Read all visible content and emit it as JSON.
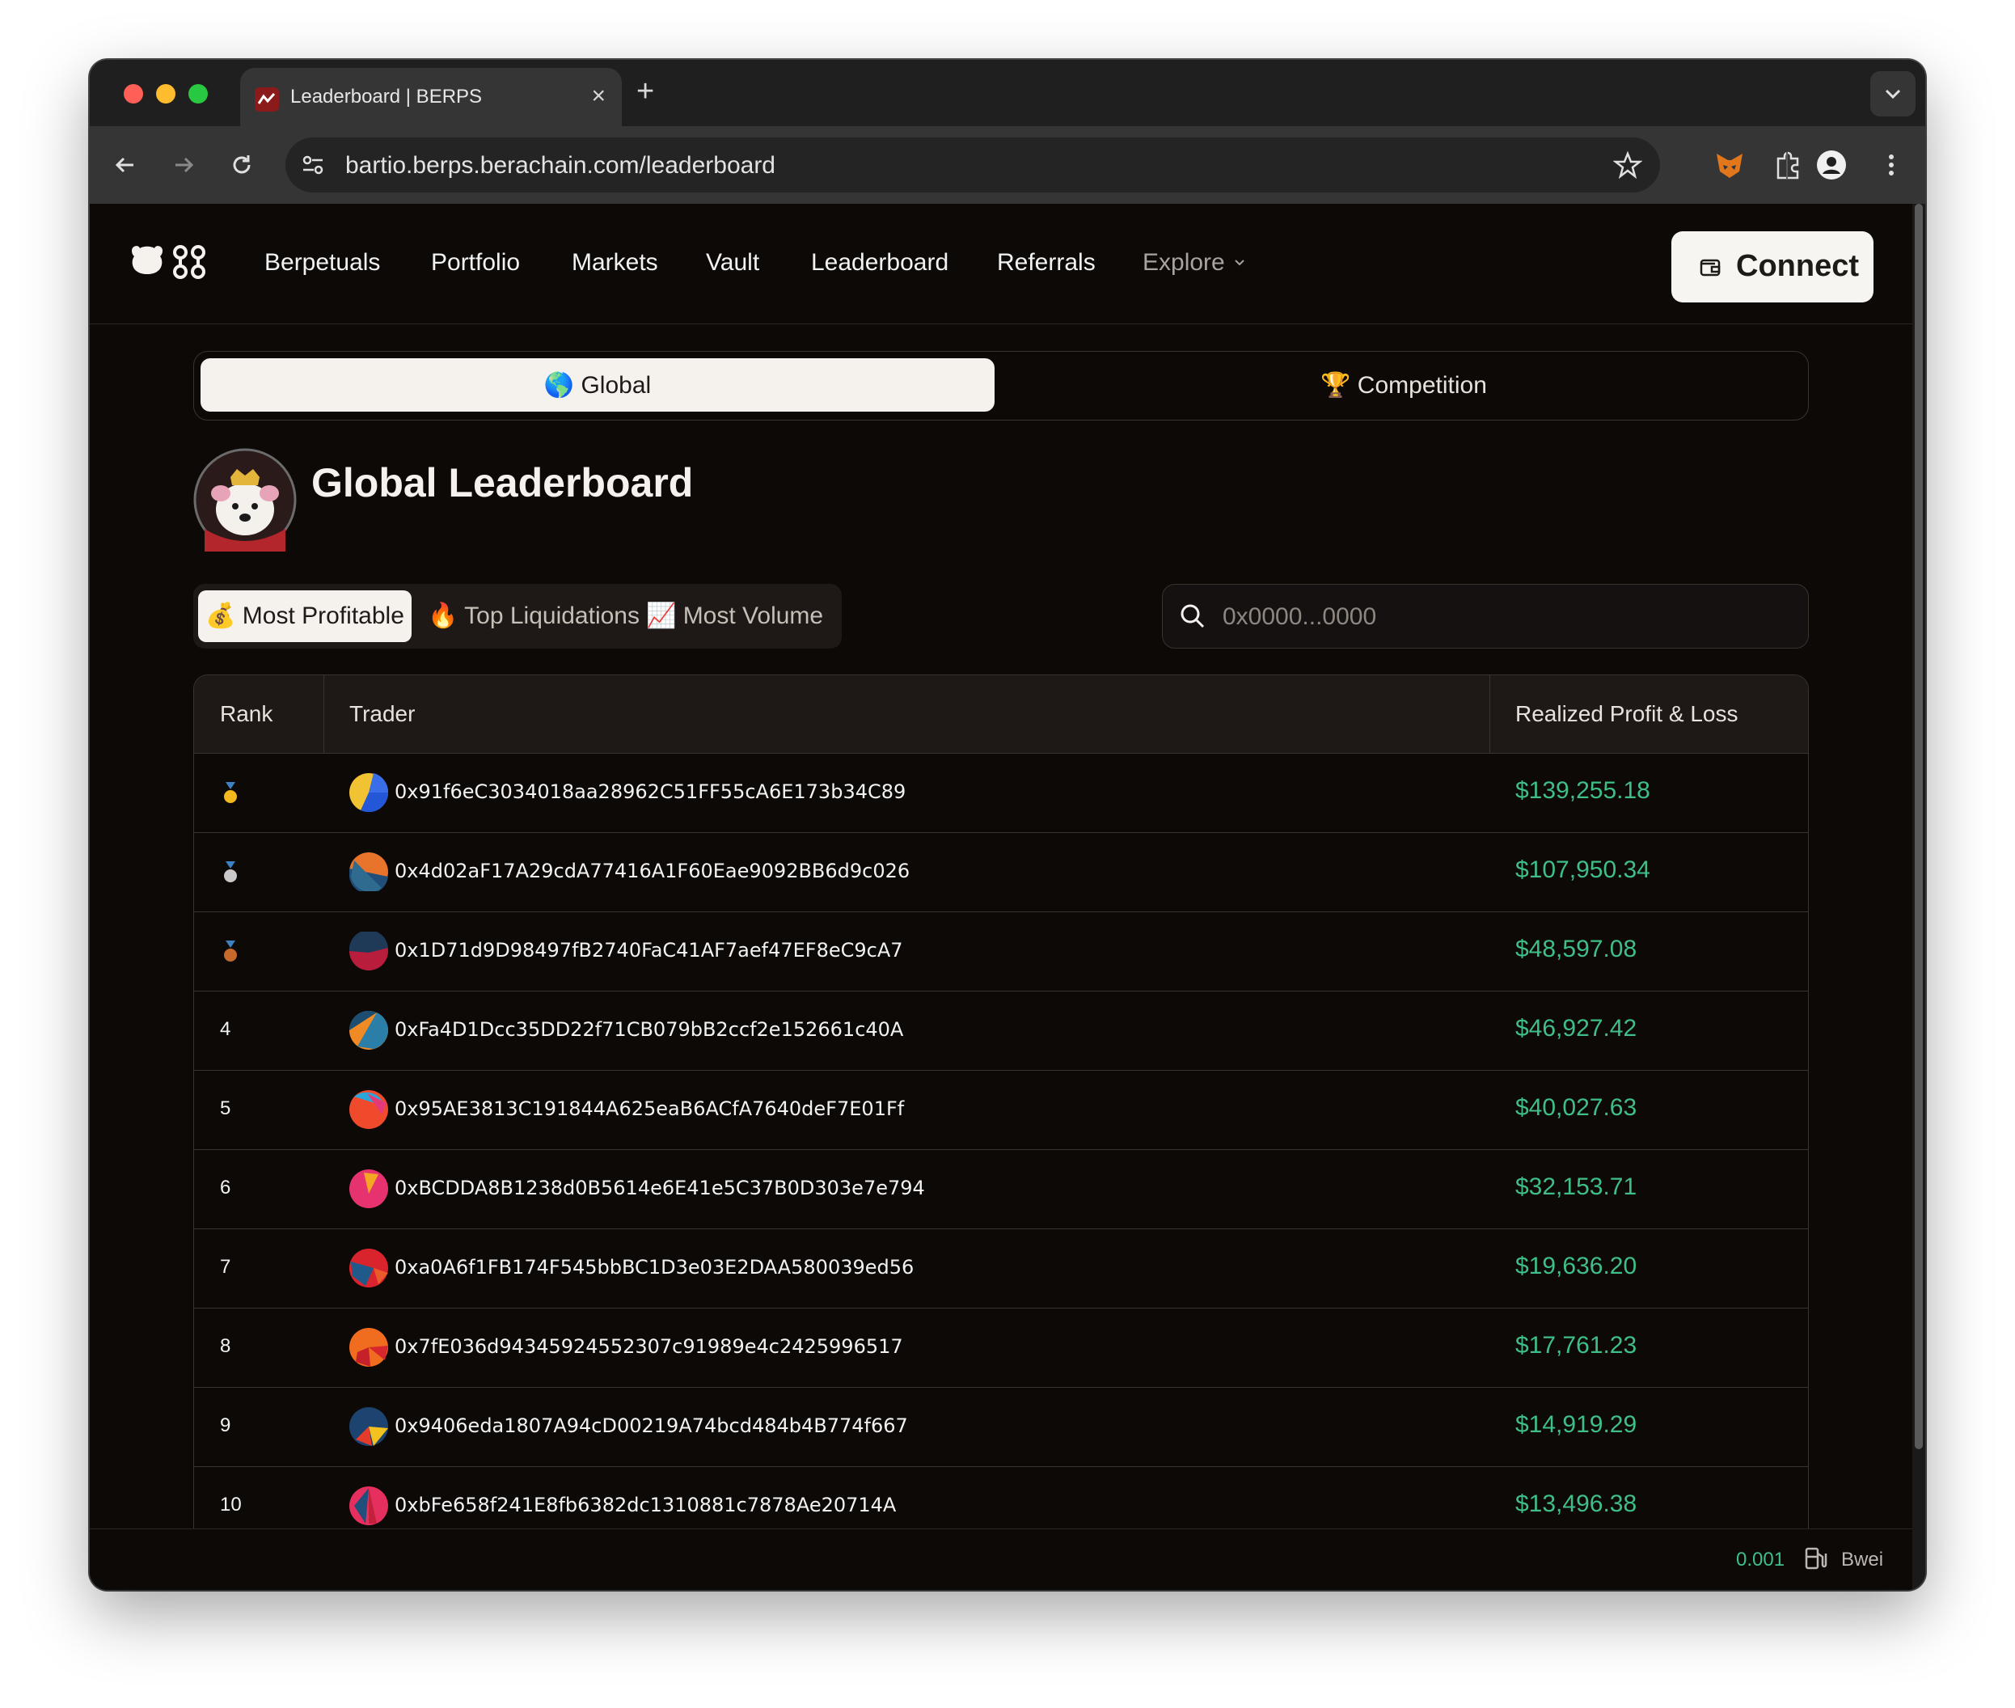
{
  "browser": {
    "tab_title": "Leaderboard | BERPS",
    "url": "bartio.berps.berachain.com/leaderboard"
  },
  "nav": {
    "items": [
      "Berpetuals",
      "Portfolio",
      "Markets",
      "Vault",
      "Leaderboard",
      "Referrals"
    ],
    "explore": "Explore",
    "connect": "Connect"
  },
  "segments": {
    "global": "🌎 Global",
    "competition": "🏆 Competition"
  },
  "title": "Global Leaderboard",
  "filters": {
    "most_profitable": "💰 Most Profitable",
    "top_liquidations": "🔥 Top Liquidations",
    "most_volume": "📈 Most Volume"
  },
  "search": {
    "placeholder": "0x0000...0000"
  },
  "table": {
    "headers": {
      "rank": "Rank",
      "trader": "Trader",
      "pnl": "Realized Profit & Loss"
    },
    "rows": [
      {
        "rank": "",
        "medal": "gold-medal-icon",
        "address": "0x91f6eC3034018aa28962C51FF55cA6E173b34C89",
        "pnl": "$139,255.18"
      },
      {
        "rank": "",
        "medal": "silver-medal-icon",
        "address": "0x4d02aF17A29cdA77416A1F60Eae9092BB6d9c026",
        "pnl": "$107,950.34"
      },
      {
        "rank": "",
        "medal": "bronze-medal-icon",
        "address": "0x1D71d9D98497fB2740FaC41AF7aef47EF8eC9cA7",
        "pnl": "$48,597.08"
      },
      {
        "rank": "4",
        "address": "0xFa4D1Dcc35DD22f71CB079bB2ccf2e152661c40A",
        "pnl": "$46,927.42"
      },
      {
        "rank": "5",
        "address": "0x95AE3813C191844A625eaB6ACfA7640deF7E01Ff",
        "pnl": "$40,027.63"
      },
      {
        "rank": "6",
        "address": "0xBCDDA8B1238d0B5614e6E41e5C37B0D303e7e794",
        "pnl": "$32,153.71"
      },
      {
        "rank": "7",
        "address": "0xa0A6f1FB174F545bbBC1D3e03E2DAA580039ed56",
        "pnl": "$19,636.20"
      },
      {
        "rank": "8",
        "address": "0x7fE036d94345924552307c91989e4c2425996517",
        "pnl": "$17,761.23"
      },
      {
        "rank": "9",
        "address": "0x9406eda1807A94cD00219A74bcd484b4B774f667",
        "pnl": "$14,919.29"
      },
      {
        "rank": "10",
        "address": "0xbFe658f241E8fb6382dc1310881c7878Ae20714A",
        "pnl": "$13,496.38"
      }
    ]
  },
  "status": {
    "gas_value": "0.001",
    "gas_unit": "Bwei"
  },
  "colors": {
    "accent_green": "#3fbf87",
    "background": "#0d0907"
  }
}
